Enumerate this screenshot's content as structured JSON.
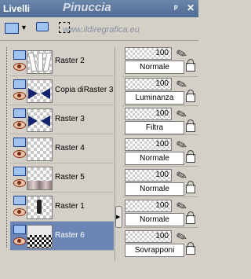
{
  "window": {
    "title": "Livelli"
  },
  "watermark": {
    "line1": "Pinuccia",
    "line2": "www.ildiregrafica.eu"
  },
  "layers": [
    {
      "name": "Raster 2",
      "opacity": "100",
      "mode": "Normale",
      "thumb": "white-stripes"
    },
    {
      "name": "Copia diRaster 3",
      "opacity": "100",
      "mode": "Luminanza",
      "thumb": "navy-bow"
    },
    {
      "name": "Raster 3",
      "opacity": "100",
      "mode": "Filtra",
      "thumb": "navy-bow"
    },
    {
      "name": "Raster 4",
      "opacity": "100",
      "mode": "Normale",
      "thumb": "transparent"
    },
    {
      "name": "Raster 5",
      "opacity": "100",
      "mode": "Normale",
      "thumb": "gray-bottom"
    },
    {
      "name": "Raster 1",
      "opacity": "100",
      "mode": "Normale",
      "thumb": "figure"
    },
    {
      "name": "Raster 6",
      "opacity": "100",
      "mode": "Sovrapponi",
      "thumb": "checker-floor",
      "selected": true
    }
  ],
  "colors": {
    "titlebar": "#5a76a0",
    "selection": "#6b86b4",
    "panel": "#d4d0c8"
  }
}
